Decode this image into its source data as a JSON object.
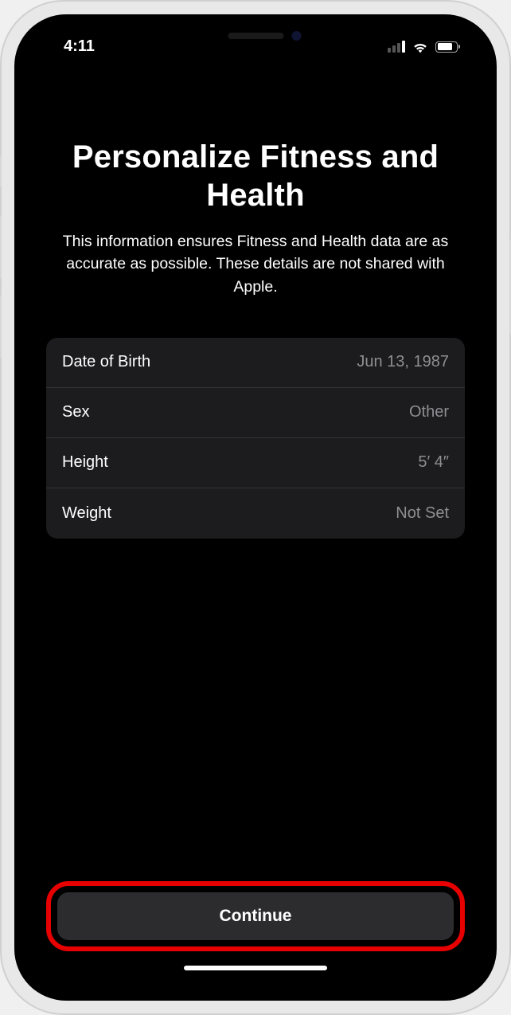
{
  "status_bar": {
    "time": "4:11"
  },
  "header": {
    "title": "Personalize Fitness and Health",
    "subtitle": "This information ensures Fitness and Health data are as accurate as possible. These details are not shared with Apple."
  },
  "details": {
    "rows": [
      {
        "label": "Date of Birth",
        "value": "Jun 13, 1987"
      },
      {
        "label": "Sex",
        "value": "Other"
      },
      {
        "label": "Height",
        "value": "5′ 4″"
      },
      {
        "label": "Weight",
        "value": "Not Set"
      }
    ]
  },
  "footer": {
    "continue_label": "Continue"
  }
}
